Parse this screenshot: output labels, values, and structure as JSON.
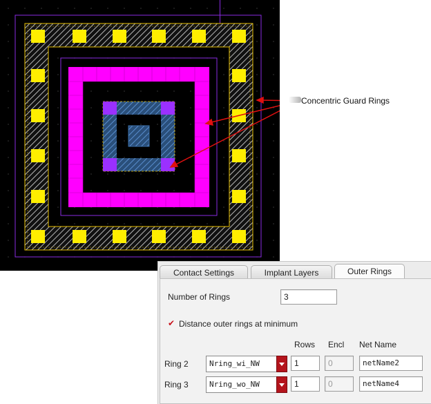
{
  "annotation": {
    "label": "Concentric Guard Rings"
  },
  "tabs": [
    {
      "label": "Contact Settings",
      "active": false
    },
    {
      "label": "Implant Layers",
      "active": false
    },
    {
      "label": "Outer Rings",
      "active": true
    }
  ],
  "number_of_rings": {
    "label": "Number of Rings",
    "value": "3"
  },
  "distance_option": {
    "label": "Distance outer rings at minimum",
    "checked": true
  },
  "columns": {
    "rows": "Rows",
    "encl": "Encl",
    "net_name": "Net Name"
  },
  "rings": [
    {
      "label": "Ring 2",
      "type": "Nring_wi_NW",
      "rows": "1",
      "encl": "0",
      "net_name": "netName2"
    },
    {
      "label": "Ring 3",
      "type": "Nring_wo_NW",
      "rows": "1",
      "encl": "0",
      "net_name": "netName4"
    }
  ],
  "colors": {
    "contact": "#ffee00",
    "metal_ring": "#ff00ff",
    "implant": "#9b30ff",
    "diffusion": "#3a6ea8",
    "well_outline": "#8a2be2",
    "arrow": "#e01010"
  }
}
